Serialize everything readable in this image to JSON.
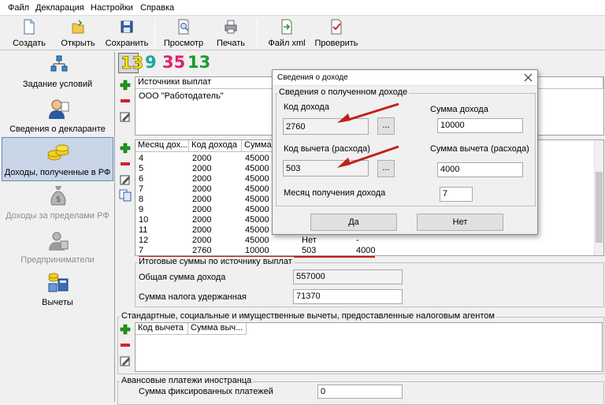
{
  "menu": [
    "Файл",
    "Декларация",
    "Настройки",
    "Справка"
  ],
  "toolbar": {
    "create": "Создать",
    "open": "Открыть",
    "save": "Сохранить",
    "preview": "Просмотр",
    "print": "Печать",
    "xml": "Файл xml",
    "check": "Проверить"
  },
  "sidebar": [
    {
      "label": "Задание условий",
      "icon": "conditions-icon"
    },
    {
      "label": "Сведения о декларанте",
      "icon": "declarant-icon"
    },
    {
      "label": "Доходы, полученные в РФ",
      "icon": "coins-icon"
    },
    {
      "label": "Доходы за пределами РФ",
      "icon": "money-bag-icon"
    },
    {
      "label": "Предприниматели",
      "icon": "entrepreneur-icon"
    },
    {
      "label": "Вычеты",
      "icon": "deductions-icon"
    }
  ],
  "rates": [
    "13",
    "9",
    "35",
    "13"
  ],
  "sources": {
    "header": "Источники выплат",
    "rows": [
      "ООО \"Работодатель\""
    ]
  },
  "income_table": {
    "headers": [
      "Месяц дох...",
      "Код дохода",
      "Сумма..."
    ],
    "rows": [
      {
        "month": "4",
        "code": "2000",
        "sum": "45000"
      },
      {
        "month": "5",
        "code": "2000",
        "sum": "45000"
      },
      {
        "month": "6",
        "code": "2000",
        "sum": "45000"
      },
      {
        "month": "7",
        "code": "2000",
        "sum": "45000"
      },
      {
        "month": "8",
        "code": "2000",
        "sum": "45000"
      },
      {
        "month": "9",
        "code": "2000",
        "sum": "45000"
      },
      {
        "month": "10",
        "code": "2000",
        "sum": "45000"
      },
      {
        "month": "11",
        "code": "2000",
        "sum": "45000"
      },
      {
        "month": "12",
        "code": "2000",
        "sum": "45000",
        "ded_code": "Нет",
        "ded_sum": "-"
      },
      {
        "month": "7",
        "code": "2760",
        "sum": "10000",
        "ded_code": "503",
        "ded_sum": "4000"
      }
    ]
  },
  "totals": {
    "title": "Итоговые суммы по источнику выплат",
    "income_label": "Общая сумма дохода",
    "income_value": "557000",
    "tax_label": "Сумма налога удержанная",
    "tax_value": "71370"
  },
  "deductions": {
    "title": "Стандартные, социальные и имущественные вычеты, предоставленные налоговым агентом",
    "headers": [
      "Код вычета",
      "Сумма выч..."
    ]
  },
  "advance": {
    "title": "Авансовые платежи иностранца",
    "label": "Сумма фиксированных платежей",
    "value": "0"
  },
  "dialog": {
    "title": "Сведения о доходе",
    "group": "Сведения о полученном доходе",
    "income_code_label": "Код дохода",
    "income_code_value": "2760",
    "income_sum_label": "Сумма дохода",
    "income_sum_value": "10000",
    "ded_code_label": "Код вычета (расхода)",
    "ded_code_value": "503",
    "ded_sum_label": "Сумма вычета (расхода)",
    "ded_sum_value": "4000",
    "month_label": "Месяц получения дохода",
    "month_value": "7",
    "browse": "...",
    "yes": "Да",
    "no": "Нет"
  },
  "colors": {
    "accent_red": "#c0201a",
    "plus_green": "#1a9a1a",
    "minus_red": "#d42020",
    "rate_yellow": "#ffe800",
    "rate_teal": "#19a7a0",
    "rate_pink": "#e02070",
    "rate_green": "#1a9a30"
  }
}
